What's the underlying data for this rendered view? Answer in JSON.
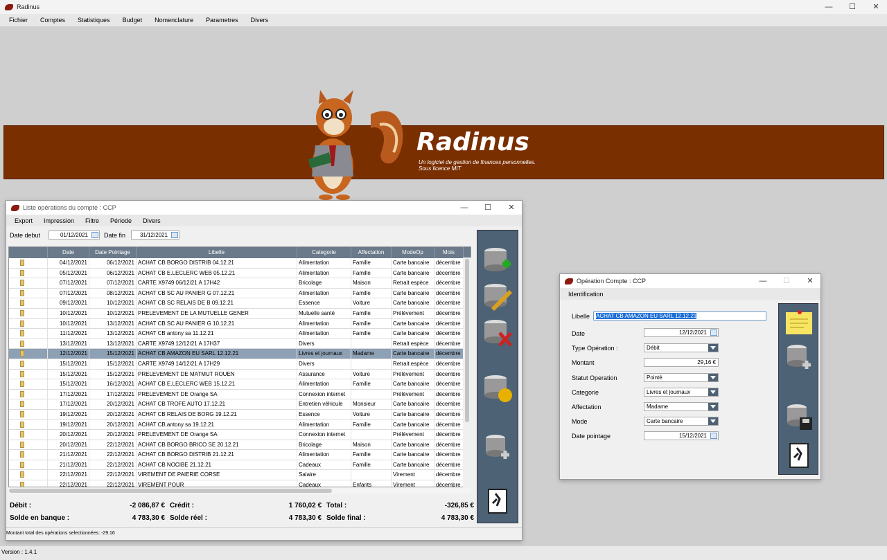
{
  "app": {
    "title": "Radinus",
    "menu": [
      "Fichier",
      "Comptes",
      "Statistiques",
      "Budget",
      "Nomenclature",
      "Parametres",
      "Divers"
    ],
    "version": "Version : 1.4.1"
  },
  "banner": {
    "title": "Radinus",
    "sub1": "Un logiciel de gestion de finances personnelles.",
    "sub2": "Sous licence MIT"
  },
  "list": {
    "title": "Liste opérations du compte : CCP",
    "menu": [
      "Export",
      "Impression",
      "Filtre",
      "Période",
      "Divers"
    ],
    "date_debut_label": "Date debut",
    "date_debut": "01/12/2021",
    "date_fin_label": "Date fin",
    "date_fin": "31/12/2021",
    "columns": [
      "Date",
      "Date Pointage",
      "Libelle",
      "Categorie",
      "Affectation",
      "ModeOp",
      "Mois"
    ],
    "rows": [
      [
        "04/12/2021",
        "06/12/2021",
        "ACHAT CB BORGO DISTRIB 04.12.21",
        "Alimentation",
        "Famille",
        "Carte bancaire",
        "décembre"
      ],
      [
        "05/12/2021",
        "06/12/2021",
        "ACHAT CB E.LECLERC WEB 05.12.21",
        "Alimentation",
        "Famille",
        "Carte bancaire",
        "décembre"
      ],
      [
        "07/12/2021",
        "07/12/2021",
        "CARTE X9749 06/12/21 A 17H42",
        "Bricolage",
        "Maison",
        "Retrait espèce",
        "décembre"
      ],
      [
        "07/12/2021",
        "08/12/2021",
        "ACHAT CB SC AU PANIER G 07.12.21",
        "Alimentation",
        "Famille",
        "Carte bancaire",
        "décembre"
      ],
      [
        "09/12/2021",
        "10/12/2021",
        "ACHAT CB SC RELAIS DE B 09.12.21",
        "Essence",
        "Voiture",
        "Carte bancaire",
        "décembre"
      ],
      [
        "10/12/2021",
        "10/12/2021",
        "PRELEVEMENT DE LA MUTUELLE GENER",
        "Mutuelle santé",
        "Famille",
        "Prélèvement",
        "décembre"
      ],
      [
        "10/12/2021",
        "13/12/2021",
        "ACHAT CB SC AU PANIER G 10.12.21",
        "Alimentation",
        "Famille",
        "Carte bancaire",
        "décembre"
      ],
      [
        "11/12/2021",
        "13/12/2021",
        "ACHAT CB antony sa 11.12.21",
        "Alimentation",
        "Famille",
        "Carte bancaire",
        "décembre"
      ],
      [
        "13/12/2021",
        "13/12/2021",
        "CARTE X9749 12/12/21 A 17H37",
        "Divers",
        "",
        "Retrait espèce",
        "décembre"
      ],
      [
        "12/12/2021",
        "15/12/2021",
        "ACHAT CB AMAZON EU SARL 12.12.21",
        "Livres et journaux",
        "Madame",
        "Carte bancaire",
        "décembre"
      ],
      [
        "15/12/2021",
        "15/12/2021",
        "CARTE X9749 14/12/21 A 17H29",
        "Divers",
        "",
        "Retrait espèce",
        "décembre"
      ],
      [
        "15/12/2021",
        "15/12/2021",
        "PRELEVEMENT DE MATMUT ROUEN",
        "Assurance",
        "Voiture",
        "Prélèvement",
        "décembre"
      ],
      [
        "15/12/2021",
        "16/12/2021",
        "ACHAT CB E.LECLERC WEB 15.12.21",
        "Alimentation",
        "Famille",
        "Carte bancaire",
        "décembre"
      ],
      [
        "17/12/2021",
        "17/12/2021",
        "PRELEVEMENT DE Orange SA",
        "Connexion internet",
        "",
        "Prélèvement",
        "décembre"
      ],
      [
        "17/12/2021",
        "20/12/2021",
        "ACHAT CB TROFE AUTO 17.12.21",
        "Entretien véhicule",
        "Monsieur",
        "Carte bancaire",
        "décembre"
      ],
      [
        "19/12/2021",
        "20/12/2021",
        "ACHAT CB RELAIS DE BORG 19.12.21",
        "Essence",
        "Voiture",
        "Carte bancaire",
        "décembre"
      ],
      [
        "19/12/2021",
        "20/12/2021",
        "ACHAT CB antony sa 19.12.21",
        "Alimentation",
        "Famille",
        "Carte bancaire",
        "décembre"
      ],
      [
        "20/12/2021",
        "20/12/2021",
        "PRELEVEMENT DE Orange SA",
        "Connexion internet",
        "",
        "Prélèvement",
        "décembre"
      ],
      [
        "20/12/2021",
        "22/12/2021",
        "ACHAT CB BORGO BRICO SE 20.12.21",
        "Bricolage",
        "Maison",
        "Carte bancaire",
        "décembre"
      ],
      [
        "21/12/2021",
        "22/12/2021",
        "ACHAT CB BORGO DISTRIB 21.12.21",
        "Alimentation",
        "Famille",
        "Carte bancaire",
        "décembre"
      ],
      [
        "21/12/2021",
        "22/12/2021",
        "ACHAT CB NOCIBE 21.12.21",
        "Cadeaux",
        "Famille",
        "Carte bancaire",
        "décembre"
      ],
      [
        "22/12/2021",
        "22/12/2021",
        "VIREMENT DE PAIERIE CORSE",
        "Salaire",
        "",
        "Virement",
        "décembre"
      ],
      [
        "22/12/2021",
        "22/12/2021",
        "VIREMENT POUR",
        "Cadeaux",
        "Enfants",
        "Virement",
        "décembre"
      ]
    ],
    "debit_label": "Débit :",
    "debit": "-2 086,87 €",
    "credit_label": "Crédit :",
    "credit": "1 760,02 €",
    "total_label": "Total :",
    "total": "-326,85 €",
    "solde_banque_label": "Solde en banque :",
    "solde_banque": "4 783,30 €",
    "solde_reel_label": "Solde réel :",
    "solde_reel": "4 783,30 €",
    "solde_final_label": "Solde final :",
    "solde_final": "4 783,30 €",
    "status": "Montant total des opérations selectionnées: -29.16"
  },
  "op": {
    "title": "Opération Compte : CCP",
    "tab": "Identification",
    "libelle_label": "Libelle",
    "libelle": "ACHAT CB AMAZON EU SARL 12.12.21",
    "date_label": "Date",
    "date": "12/12/2021",
    "type_label": "Type Opération :",
    "type": "Débit",
    "montant_label": "Montant",
    "montant": "29,16 €",
    "statut_label": "Statut Operation",
    "statut": "Pointé",
    "categorie_label": "Categorie",
    "categorie": "Livres et journaux",
    "affectation_label": "Affectation",
    "affectation": "Madame",
    "mode_label": "Mode",
    "mode": "Carte bancaire",
    "pointage_label": "Date pointage",
    "pointage": "15/12/2021"
  },
  "colors": {
    "banner": "#7a2f00",
    "panel": "#4d6275",
    "header": "#6a7a8a",
    "selected": "#8ea0b4"
  }
}
